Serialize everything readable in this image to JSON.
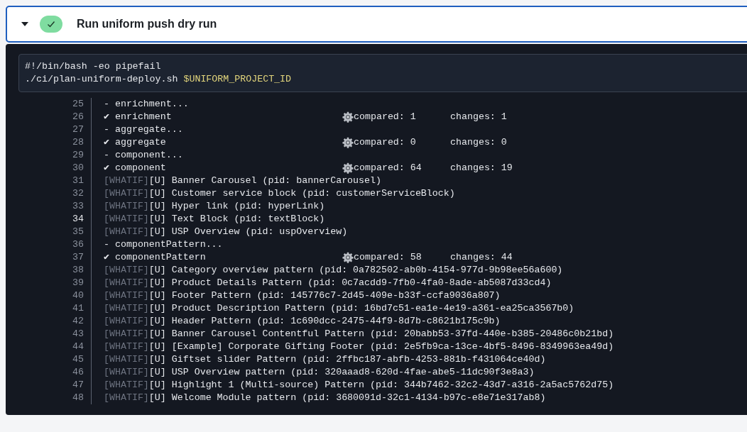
{
  "step": {
    "title": "Run uniform push dry run",
    "succeeded": true,
    "expanded": true
  },
  "script": [
    {
      "text": "#!/bin/bash -eo pipefail"
    },
    {
      "text": "./ci/plan-uniform-deploy.sh",
      "variable": "$UNIFORM_PROJECT_ID"
    }
  ],
  "log": [
    {
      "number": "25",
      "kind": "plain",
      "text": "- enrichment...",
      "highlighted": false
    },
    {
      "number": "26",
      "kind": "step",
      "text": "✔ enrichment",
      "compared": "compared: 1",
      "changes": "changes: 1",
      "highlighted": false
    },
    {
      "number": "27",
      "kind": "plain",
      "text": "- aggregate...",
      "highlighted": false
    },
    {
      "number": "28",
      "kind": "step",
      "text": "✔ aggregate",
      "compared": "compared: 0",
      "changes": "changes: 0",
      "highlighted": false
    },
    {
      "number": "29",
      "kind": "plain",
      "text": "- component...",
      "highlighted": false
    },
    {
      "number": "30",
      "kind": "step",
      "text": "✔ component",
      "compared": "compared: 64",
      "changes": "changes: 19",
      "highlighted": false
    },
    {
      "number": "31",
      "kind": "whatif",
      "tag": "[WHATIF]",
      "text": "[U] Banner Carousel (pid: bannerCarousel)",
      "highlighted": false
    },
    {
      "number": "32",
      "kind": "whatif",
      "tag": "[WHATIF]",
      "text": "[U] Customer service block (pid: customerServiceBlock)",
      "highlighted": false
    },
    {
      "number": "33",
      "kind": "whatif",
      "tag": "[WHATIF]",
      "text": "[U] Hyper link (pid: hyperLink)",
      "highlighted": false
    },
    {
      "number": "34",
      "kind": "whatif",
      "tag": "[WHATIF]",
      "text": "[U] Text Block (pid: textBlock)",
      "highlighted": true
    },
    {
      "number": "35",
      "kind": "whatif",
      "tag": "[WHATIF]",
      "text": "[U] USP Overview (pid: uspOverview)",
      "highlighted": false
    },
    {
      "number": "36",
      "kind": "plain",
      "text": "- componentPattern...",
      "highlighted": false
    },
    {
      "number": "37",
      "kind": "step",
      "text": "✔ componentPattern",
      "compared": "compared: 58",
      "changes": "changes: 44",
      "highlighted": false
    },
    {
      "number": "38",
      "kind": "whatif",
      "tag": "[WHATIF]",
      "text": "[U] Category overview pattern (pid: 0a782502-ab0b-4154-977d-9b98ee56a600)",
      "highlighted": false
    },
    {
      "number": "39",
      "kind": "whatif",
      "tag": "[WHATIF]",
      "text": "[U] Product Details Pattern (pid: 0c7acdd9-7fb0-4fa0-8ade-ab5087d33cd4)",
      "highlighted": false
    },
    {
      "number": "40",
      "kind": "whatif",
      "tag": "[WHATIF]",
      "text": "[U] Footer Pattern (pid: 145776c7-2d45-409e-b33f-ccfa9036a807)",
      "highlighted": false
    },
    {
      "number": "41",
      "kind": "whatif",
      "tag": "[WHATIF]",
      "text": "[U] Product Description Pattern (pid: 16bd7c51-ea1e-4e19-a361-ea25ca3567b0)",
      "highlighted": false
    },
    {
      "number": "42",
      "kind": "whatif",
      "tag": "[WHATIF]",
      "text": "[U] Header Pattern (pid: 1c690dcc-2475-44f9-8d7b-c8621b175c9b)",
      "highlighted": false
    },
    {
      "number": "43",
      "kind": "whatif",
      "tag": "[WHATIF]",
      "text": "[U] Banner Carousel Contentful Pattern (pid: 20babb53-37fd-440e-b385-20486c0b21bd)",
      "highlighted": false
    },
    {
      "number": "44",
      "kind": "whatif",
      "tag": "[WHATIF]",
      "text": "[U] [Example] Corporate Gifting Footer (pid: 2e5fb9ca-13ce-4bf5-8496-8349963ea49d)",
      "highlighted": false
    },
    {
      "number": "45",
      "kind": "whatif",
      "tag": "[WHATIF]",
      "text": "[U] Giftset slider Pattern (pid: 2ffbc187-abfb-4253-881b-f431064ce40d)",
      "highlighted": false
    },
    {
      "number": "46",
      "kind": "whatif",
      "tag": "[WHATIF]",
      "text": "[U] USP Overview pattern (pid: 320aaad8-620d-4fae-abe5-11dc90f3e8a3)",
      "highlighted": false
    },
    {
      "number": "47",
      "kind": "whatif",
      "tag": "[WHATIF]",
      "text": "[U] Highlight 1 (Multi-source) Pattern (pid: 344b7462-32c2-43d7-a316-2a5ac5762d75)",
      "highlighted": false
    },
    {
      "number": "48",
      "kind": "whatif",
      "tag": "[WHATIF]",
      "text": "[U] Welcome Module pattern (pid: 3680091d-32c1-4134-b97c-e8e71e317ab8)",
      "highlighted": false
    }
  ]
}
